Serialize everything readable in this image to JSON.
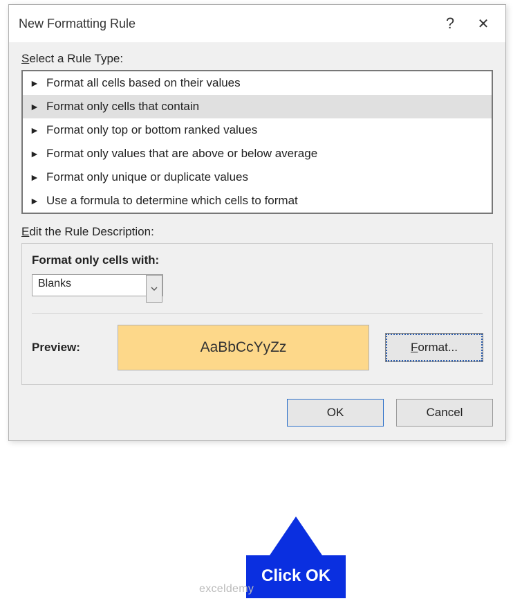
{
  "titlebar": {
    "title": "New Formatting Rule",
    "help_label": "?",
    "close_label": "✕"
  },
  "rule_type": {
    "label_pre": "S",
    "label_rest": "elect a Rule Type:",
    "items": [
      "Format all cells based on their values",
      "Format only cells that contain",
      "Format only top or bottom ranked values",
      "Format only values that are above or below average",
      "Format only unique or duplicate values",
      "Use a formula to determine which cells to format"
    ],
    "selected_index": 1
  },
  "edit": {
    "label_pre": "E",
    "label_rest": "dit the Rule Description:",
    "heading": "Format only cells with:",
    "combo_value": "Blanks",
    "preview_label": "Preview:",
    "preview_text": "AaBbCcYyZz",
    "format_btn_ul": "F",
    "format_btn_rest": "ormat..."
  },
  "footer": {
    "ok": "OK",
    "cancel": "Cancel"
  },
  "callout": "Click OK",
  "watermark": "exceldemy"
}
